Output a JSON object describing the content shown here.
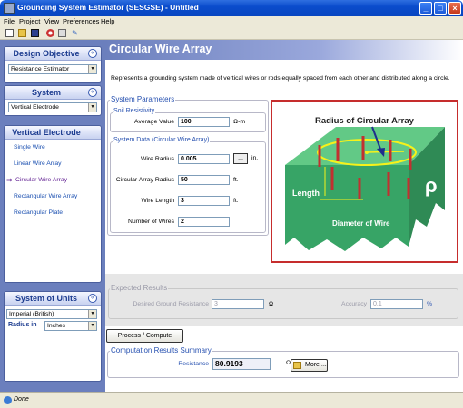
{
  "window": {
    "title": "Grounding System Estimator (SESGSE) - Untitled"
  },
  "menu": [
    "File",
    "Project",
    "View",
    "Preferences",
    "Help"
  ],
  "sidebar": {
    "design_objective": {
      "title": "Design Objective",
      "selected": "Resistance Estimator"
    },
    "system": {
      "title": "System",
      "selected": "Vertical Electrode"
    },
    "vertical_electrode": {
      "title": "Vertical Electrode",
      "items": [
        "Single Wire",
        "Linear Wire Array",
        "Circular Wire Array",
        "Rectangular Wire Array",
        "Rectangular Plate"
      ]
    },
    "units": {
      "title": "System of Units",
      "selected": "Imperial (British)",
      "radius_label": "Radius in",
      "radius_selected": "Inches"
    }
  },
  "main": {
    "title": "Circular Wire Array",
    "description": "Represents a grounding system made of vertical wires or rods equally spaced from each other and distributed along a circle.",
    "params_title": "System Parameters",
    "soil": {
      "title": "Soil Resistivity",
      "avg_label": "Average Value",
      "avg_value": "100",
      "unit": "Ω-m"
    },
    "data_title": "System Data (Circular Wire Array)",
    "wire_radius": {
      "label": "Wire Radius",
      "value": "0.005",
      "unit": "in.",
      "btn": "..."
    },
    "circular_radius": {
      "label": "Circular Array Radius",
      "value": "50",
      "unit": "ft."
    },
    "wire_length": {
      "label": "Wire Length",
      "value": "3",
      "unit": "ft."
    },
    "num_wires": {
      "label": "Number of Wires",
      "value": "2"
    },
    "figure": {
      "radius_label": "Radius of Circular Array",
      "length_label": "Length",
      "diameter_label": "Diameter of Wire",
      "rho": "ρ"
    },
    "expected": {
      "title": "Expected Results",
      "resistance_label": "Desired Ground Resistance",
      "resistance_value": "3",
      "resistance_unit": "Ω",
      "accuracy_label": "Accuracy",
      "accuracy_value": "0.1",
      "accuracy_unit": "%"
    },
    "process_btn": "Process / Compute",
    "summary": {
      "title": "Computation Results Summary",
      "resistance_label": "Resistance",
      "resistance_value": "80.9193",
      "unit": "Ω",
      "more_btn": "More ..."
    }
  },
  "status": {
    "text": "Done"
  }
}
